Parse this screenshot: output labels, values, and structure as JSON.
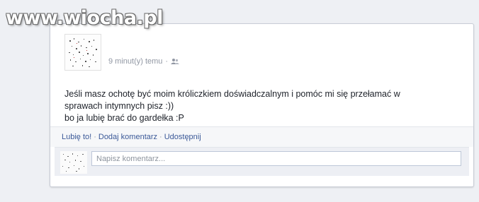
{
  "watermark": {
    "text": "www.wiocha.pl"
  },
  "post": {
    "time": "9 minut(y) temu",
    "separator": "·",
    "privacy_icon": "friends-icon",
    "lines": [
      "Jeśli masz ochotę być moim króliczkiem doświadczalnym i pomóc mi się przełamać w",
      "sprawach intymnych pisz :))",
      "bo ja lubię brać do gardełka :P"
    ]
  },
  "actions": {
    "like": "Lubię to!",
    "comment": "Dodaj komentarz",
    "share": "Udostępnij",
    "separator": "·"
  },
  "comment_box": {
    "placeholder": "Napisz komentarz..."
  },
  "colors": {
    "link": "#3b5998",
    "meta": "#9197a3",
    "background": "#eef0f4"
  }
}
